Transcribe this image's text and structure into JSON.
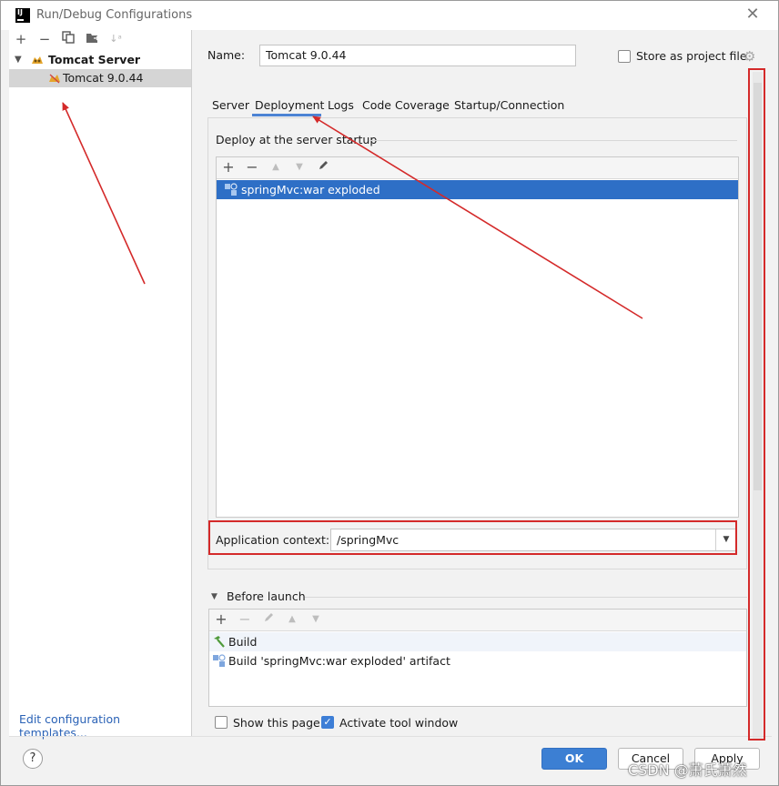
{
  "window": {
    "title": "Run/Debug Configurations"
  },
  "sidebar": {
    "tree": [
      {
        "label": "Tomcat Server",
        "expanded": true
      },
      {
        "label": "Tomcat 9.0.44",
        "selected": true
      }
    ],
    "edit_templates_link": "Edit configuration templates..."
  },
  "form": {
    "name_label": "Name:",
    "name_value": "Tomcat 9.0.44",
    "store_label": "Store as project file"
  },
  "tabs": [
    {
      "label": "Server"
    },
    {
      "label": "Deployment",
      "active": true
    },
    {
      "label": "Logs"
    },
    {
      "label": "Code Coverage"
    },
    {
      "label": "Startup/Connection"
    }
  ],
  "deployment": {
    "section_title": "Deploy at the server startup",
    "items": [
      {
        "label": "springMvc:war exploded",
        "selected": true
      }
    ],
    "app_context_label": "Application context:",
    "app_context_value": "/springMvc"
  },
  "before_launch": {
    "title": "Before launch",
    "items": [
      {
        "label": "Build"
      },
      {
        "label": "Build 'springMvc:war exploded' artifact"
      }
    ]
  },
  "options": {
    "show_page_label": "Show this page",
    "show_page_checked": false,
    "activate_tool_label": "Activate tool window",
    "activate_tool_checked": true
  },
  "buttons": {
    "help": "?",
    "ok": "OK",
    "cancel": "Cancel",
    "apply": "Apply"
  },
  "watermark": "CSDN @萧氏萧然",
  "colors": {
    "accent": "#3c7fd3",
    "selection": "#2e6fc6",
    "annotation": "#d42a2a"
  }
}
